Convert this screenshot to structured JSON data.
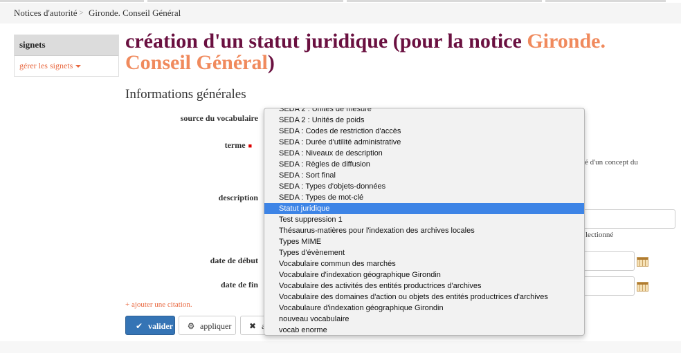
{
  "breadcrumb": {
    "items": [
      "Notices d'autorité",
      "Gironde. Conseil Général"
    ],
    "separator": ">"
  },
  "sidebar": {
    "title": "signets",
    "manage_link": "gérer les signets"
  },
  "page": {
    "title_prefix": "création d'un statut juridique (pour la notice ",
    "title_entity": "Gironde. Conseil Général",
    "title_suffix": ")",
    "section_title": "Informations générales"
  },
  "form": {
    "source_label": "source du vocabulaire",
    "term_label": "terme",
    "required_marker": "■",
    "description_label": "description",
    "start_date_label": "date de début",
    "end_date_label": "date de fin",
    "hint_concept": "é d'un concept du",
    "hint_selected": "lectionné",
    "add_citation": "+ ajouter une citation."
  },
  "buttons": {
    "validate": "valider",
    "apply": "appliquer",
    "cancel_fragment": "a"
  },
  "dropdown": {
    "selected": "Statut juridique",
    "options": [
      "SEDA 2 : Unités de mesure",
      "SEDA 2 : Unités de poids",
      "SEDA : Codes de restriction d'accès",
      "SEDA : Durée d'utilité administrative",
      "SEDA : Niveaux de description",
      "SEDA : Règles de diffusion",
      "SEDA : Sort final",
      "SEDA : Types d'objets-données",
      "SEDA : Types de mot-clé",
      "Statut juridique",
      "Test suppression 1",
      "Thésaurus-matières pour l'indexation des archives locales",
      "Types MIME",
      "Types d'évènement",
      "Vocabulaire commun des marchés",
      "Vocabulaire d'indexation géographique Girondin",
      "Vocabulaire des activités des entités productrices d'archives",
      "Vocabulaire des domaines d'action ou objets des entités productrices d'archives",
      "Vocabulaure d'indexation géographique Girondin",
      "nouveau vocabulaire",
      "vocab enorme"
    ]
  },
  "colors": {
    "title": "#6a1040",
    "accent": "#f08a5d",
    "link": "#e8663d",
    "primary_button": "#3574b5",
    "selection": "#3d84e6"
  }
}
